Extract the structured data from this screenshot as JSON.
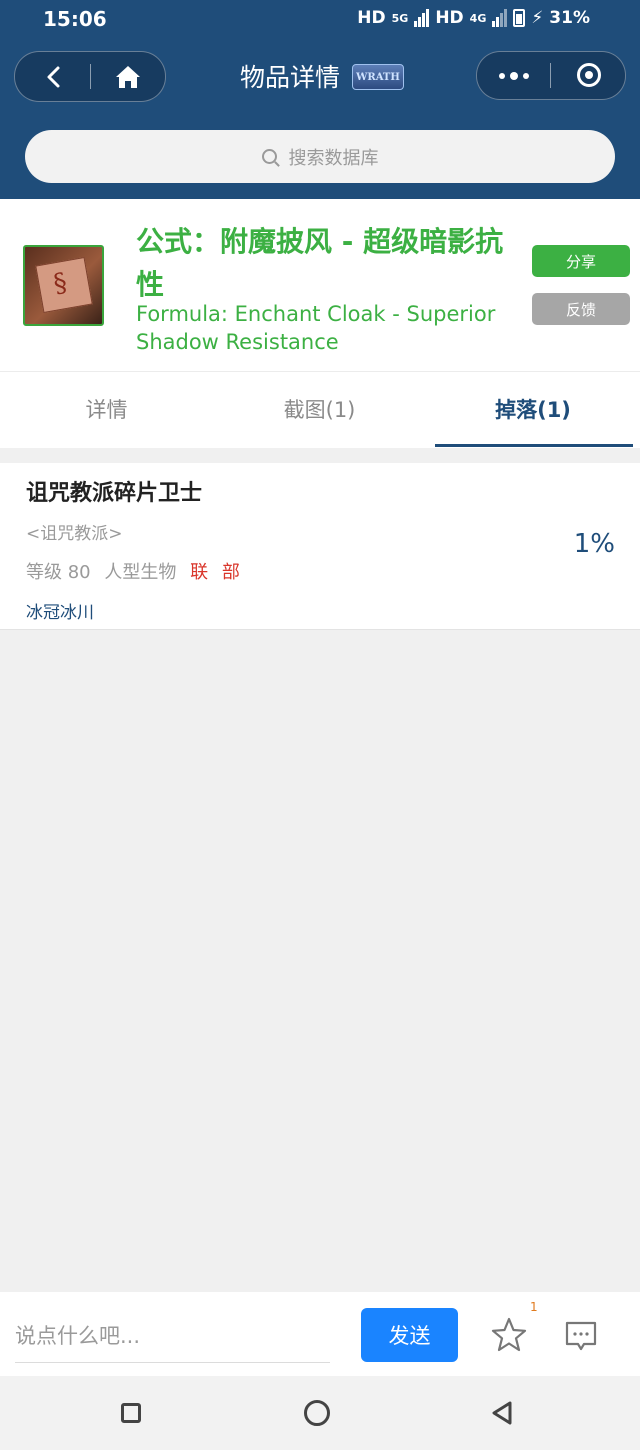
{
  "status": {
    "time": "15:06",
    "network1": "HD",
    "network1_gen": "5G",
    "network2": "HD",
    "network2_gen": "4G",
    "battery": "31%"
  },
  "header": {
    "title": "物品详情",
    "logo_text": "WRATH"
  },
  "search": {
    "placeholder": "搜索数据库"
  },
  "item": {
    "name_cn": "公式：附魔披风 - 超级暗影抗性",
    "name_en": "Formula: Enchant Cloak - Superior Shadow Resistance",
    "share_label": "分享",
    "feedback_label": "反馈",
    "quality_color": "#3cb043"
  },
  "tabs": [
    {
      "label": "详情",
      "active": false
    },
    {
      "label": "截图(1)",
      "active": false
    },
    {
      "label": "掉落(1)",
      "active": true
    }
  ],
  "drops": [
    {
      "name": "诅咒教派碎片卫士",
      "faction": "<诅咒教派>",
      "level": "等级 80",
      "type": "人型生物",
      "alliance": "联",
      "horde": "部",
      "zone": "冰冠冰川",
      "rate": "1%"
    }
  ],
  "comment": {
    "placeholder": "说点什么吧...",
    "send_label": "发送",
    "star_count": "1"
  },
  "colors": {
    "header_bg": "#1f4d7a",
    "accent_blue": "#1a84ff",
    "green": "#3cb043",
    "red": "#d9362b"
  }
}
